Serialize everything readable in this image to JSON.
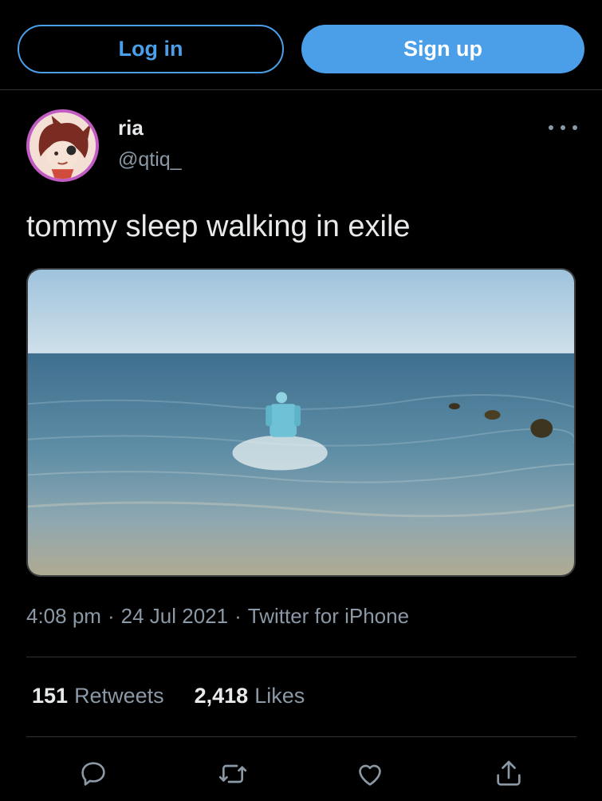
{
  "header": {
    "login_label": "Log in",
    "signup_label": "Sign up"
  },
  "tweet": {
    "display_name": "ria",
    "handle": "@qtiq_",
    "text": "tommy sleep walking in exile",
    "time": "4:08 pm",
    "date": "24 Jul 2021",
    "source": "Twitter for iPhone",
    "separator": "·",
    "retweets_count": "151",
    "retweets_label": "Retweets",
    "likes_count": "2,418",
    "likes_label": "Likes"
  },
  "actions": [
    "reply-icon",
    "retweet-icon",
    "like-icon",
    "share-icon"
  ],
  "colors": {
    "accent": "#4a9fe8",
    "background": "#000000",
    "secondary_text": "#8b98a5",
    "avatar_border": "#c25bc4"
  }
}
